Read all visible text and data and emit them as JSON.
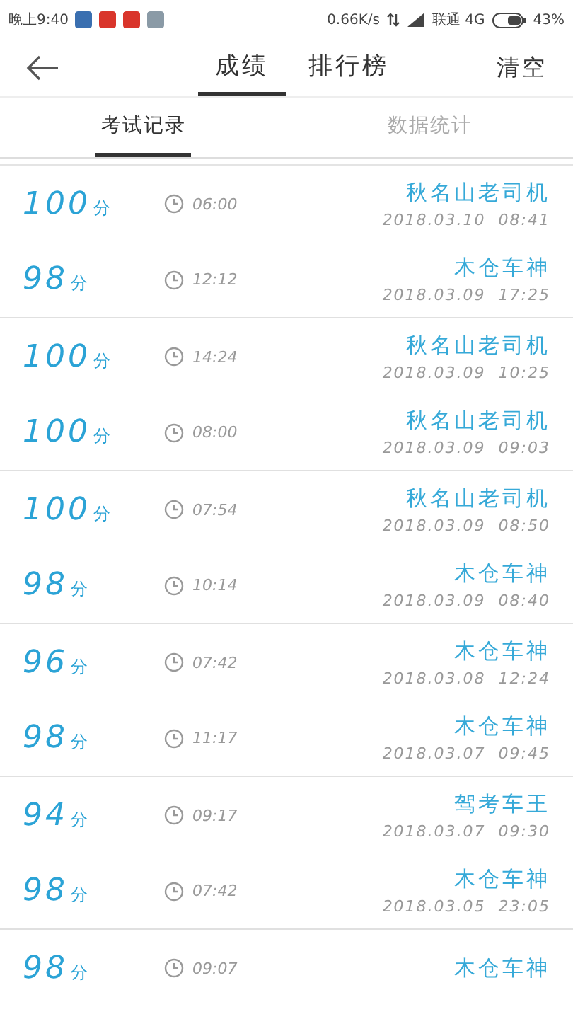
{
  "status_bar": {
    "time": "晚上9:40",
    "speed": "0.66K/s",
    "carrier": "联通 4G",
    "battery": "43%"
  },
  "header": {
    "tabs": [
      {
        "label": "成绩",
        "selected": true
      },
      {
        "label": "排行榜",
        "selected": false
      }
    ],
    "action": "清空"
  },
  "subtabs": [
    {
      "label": "考试记录",
      "selected": true
    },
    {
      "label": "数据统计",
      "selected": false
    }
  ],
  "records": [
    {
      "score": "100",
      "unit": "分",
      "duration": "06:00",
      "name": "秋名山老司机",
      "date": "2018.03.10  08:41"
    },
    {
      "score": "98",
      "unit": "分",
      "duration": "12:12",
      "name": "木仓车神",
      "date": "2018.03.09  17:25"
    },
    {
      "score": "100",
      "unit": "分",
      "duration": "14:24",
      "name": "秋名山老司机",
      "date": "2018.03.09  10:25"
    },
    {
      "score": "100",
      "unit": "分",
      "duration": "08:00",
      "name": "秋名山老司机",
      "date": "2018.03.09  09:03"
    },
    {
      "score": "100",
      "unit": "分",
      "duration": "07:54",
      "name": "秋名山老司机",
      "date": "2018.03.09  08:50"
    },
    {
      "score": "98",
      "unit": "分",
      "duration": "10:14",
      "name": "木仓车神",
      "date": "2018.03.09  08:40"
    },
    {
      "score": "96",
      "unit": "分",
      "duration": "07:42",
      "name": "木仓车神",
      "date": "2018.03.08  12:24"
    },
    {
      "score": "98",
      "unit": "分",
      "duration": "11:17",
      "name": "木仓车神",
      "date": "2018.03.07  09:45"
    },
    {
      "score": "94",
      "unit": "分",
      "duration": "09:17",
      "name": "驾考车王",
      "date": "2018.03.07  09:30"
    },
    {
      "score": "98",
      "unit": "分",
      "duration": "07:42",
      "name": "木仓车神",
      "date": "2018.03.05  23:05"
    },
    {
      "score": "98",
      "unit": "分",
      "duration": "09:07",
      "name": "木仓车神"
    }
  ]
}
